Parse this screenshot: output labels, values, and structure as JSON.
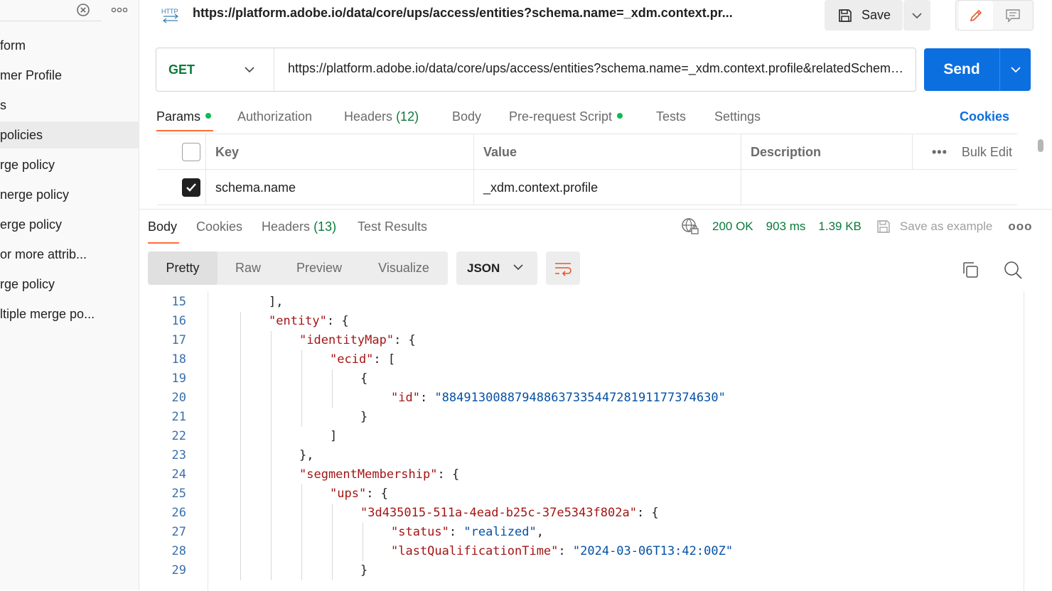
{
  "sidebar": {
    "items": [
      {
        "label": "form",
        "active": false
      },
      {
        "label": "mer Profile",
        "active": false
      },
      {
        "label": "s",
        "active": false
      },
      {
        "label": "policies",
        "active": true
      },
      {
        "label": "rge policy",
        "active": false
      },
      {
        "label": "nerge policy",
        "active": false
      },
      {
        "label": "erge policy",
        "active": false
      },
      {
        "label": " or more attrib...",
        "active": false
      },
      {
        "label": "rge policy",
        "active": false
      },
      {
        "label": "ltiple merge po...",
        "active": false
      }
    ]
  },
  "tab": {
    "icon_text": "HTTP",
    "url": "https://platform.adobe.io/data/core/ups/access/entities?schema.name=_xdm.context.pr..."
  },
  "toolbar": {
    "save_label": "Save"
  },
  "request": {
    "method": "GET",
    "url": "https://platform.adobe.io/data/core/ups/access/entities?schema.name=_xdm.context.profile&relatedSchema.name=_xdm.context.experienceevent&entityId=88491300887948863733544728191177374630&entityIdNS=ecid",
    "send_label": "Send"
  },
  "request_tabs": {
    "params": "Params",
    "authorization": "Authorization",
    "headers": "Headers",
    "headers_count": "(12)",
    "body": "Body",
    "prerequest": "Pre-request Script",
    "tests": "Tests",
    "settings": "Settings",
    "cookies": "Cookies"
  },
  "params_table": {
    "headers": {
      "key": "Key",
      "value": "Value",
      "description": "Description",
      "bulk_edit": "Bulk Edit",
      "more": "•••"
    },
    "rows": [
      {
        "checked": true,
        "key": "schema.name",
        "value": "_xdm.context.profile",
        "description": ""
      }
    ]
  },
  "response": {
    "tabs": {
      "body": "Body",
      "cookies": "Cookies",
      "headers": "Headers",
      "headers_count": "(13)",
      "test_results": "Test Results"
    },
    "status": "200 OK",
    "time": "903 ms",
    "size": "1.39 KB",
    "save_example": "Save as example",
    "more": "ooo",
    "views": {
      "pretty": "Pretty",
      "raw": "Raw",
      "preview": "Preview",
      "visualize": "Visualize"
    },
    "format": "JSON"
  },
  "code_lines": [
    {
      "n": "15",
      "indent": 2,
      "parts": [
        [
          "p",
          "],"
        ]
      ]
    },
    {
      "n": "16",
      "indent": 2,
      "parts": [
        [
          "k",
          "\"entity\""
        ],
        [
          "p",
          ": {"
        ]
      ]
    },
    {
      "n": "17",
      "indent": 3,
      "parts": [
        [
          "k",
          "\"identityMap\""
        ],
        [
          "p",
          ": {"
        ]
      ]
    },
    {
      "n": "18",
      "indent": 4,
      "parts": [
        [
          "k",
          "\"ecid\""
        ],
        [
          "p",
          ": ["
        ]
      ]
    },
    {
      "n": "19",
      "indent": 5,
      "parts": [
        [
          "p",
          "{"
        ]
      ]
    },
    {
      "n": "20",
      "indent": 6,
      "parts": [
        [
          "k",
          "\"id\""
        ],
        [
          "p",
          ": "
        ],
        [
          "s",
          "\"88491300887948863733544728191177374630\""
        ]
      ]
    },
    {
      "n": "21",
      "indent": 5,
      "parts": [
        [
          "p",
          "}"
        ]
      ]
    },
    {
      "n": "22",
      "indent": 4,
      "parts": [
        [
          "p",
          "]"
        ]
      ]
    },
    {
      "n": "23",
      "indent": 3,
      "parts": [
        [
          "p",
          "},"
        ]
      ]
    },
    {
      "n": "24",
      "indent": 3,
      "parts": [
        [
          "k",
          "\"segmentMembership\""
        ],
        [
          "p",
          ": {"
        ]
      ]
    },
    {
      "n": "25",
      "indent": 4,
      "parts": [
        [
          "k",
          "\"ups\""
        ],
        [
          "p",
          ": {"
        ]
      ]
    },
    {
      "n": "26",
      "indent": 5,
      "parts": [
        [
          "k",
          "\"3d435015-511a-4ead-b25c-37e5343f802a\""
        ],
        [
          "p",
          ": {"
        ]
      ]
    },
    {
      "n": "27",
      "indent": 6,
      "parts": [
        [
          "k",
          "\"status\""
        ],
        [
          "p",
          ": "
        ],
        [
          "s",
          "\"realized\""
        ],
        [
          "p",
          ","
        ]
      ]
    },
    {
      "n": "28",
      "indent": 6,
      "parts": [
        [
          "k",
          "\"lastQualificationTime\""
        ],
        [
          "p",
          ": "
        ],
        [
          "s",
          "\"2024-03-06T13:42:00Z\""
        ]
      ]
    },
    {
      "n": "29",
      "indent": 5,
      "parts": [
        [
          "p",
          "}"
        ]
      ]
    }
  ],
  "colors": {
    "accent": "#0b6fe0",
    "method_get": "#0b7a3b",
    "tab_active_underline": "#ff6c37",
    "status_green": "#0b7a3b",
    "json_key": "#a31515",
    "json_string": "#0451a5"
  }
}
